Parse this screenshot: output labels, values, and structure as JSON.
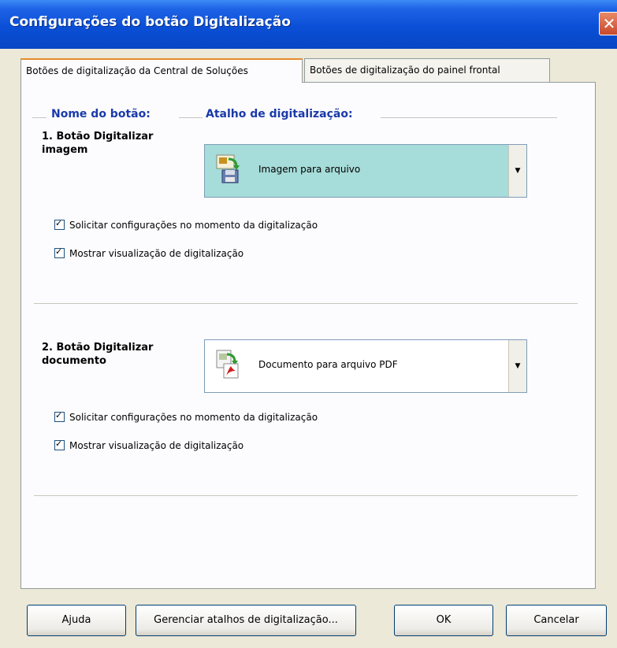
{
  "window": {
    "title": "Configurações do botão Digitalização",
    "close_symbol": "✕"
  },
  "tabs": [
    {
      "label": "Botões de digitalização da Central de Soluções",
      "active": true
    },
    {
      "label": "Botões de digitalização do painel frontal",
      "active": false
    }
  ],
  "headers": {
    "button_name": "Nome do botão:",
    "shortcut": "Atalho de digitalização:"
  },
  "sections": [
    {
      "label_line1": "1. Botão Digitalizar",
      "label_line2": "imagem",
      "selected": "Imagem para arquivo",
      "icon": "image-to-file-icon",
      "highlight": "#a6dcd9",
      "checkboxes": [
        {
          "label": "Solicitar configurações no momento da digitalização",
          "checked": true
        },
        {
          "label": "Mostrar visualização de digitalização",
          "checked": true
        }
      ]
    },
    {
      "label_line1": "2. Botão Digitalizar",
      "label_line2": "documento",
      "selected": "Documento para arquivo PDF",
      "icon": "document-to-pdf-icon",
      "highlight": "#ffffff",
      "checkboxes": [
        {
          "label": "Solicitar configurações no momento da digitalização",
          "checked": true
        },
        {
          "label": "Mostrar visualização de digitalização",
          "checked": true
        }
      ]
    }
  ],
  "buttons": {
    "help": "Ajuda",
    "manage": "Gerenciar atalhos de digitalização...",
    "ok": "OK",
    "cancel": "Cancelar"
  },
  "dropdown_arrow": "▼"
}
